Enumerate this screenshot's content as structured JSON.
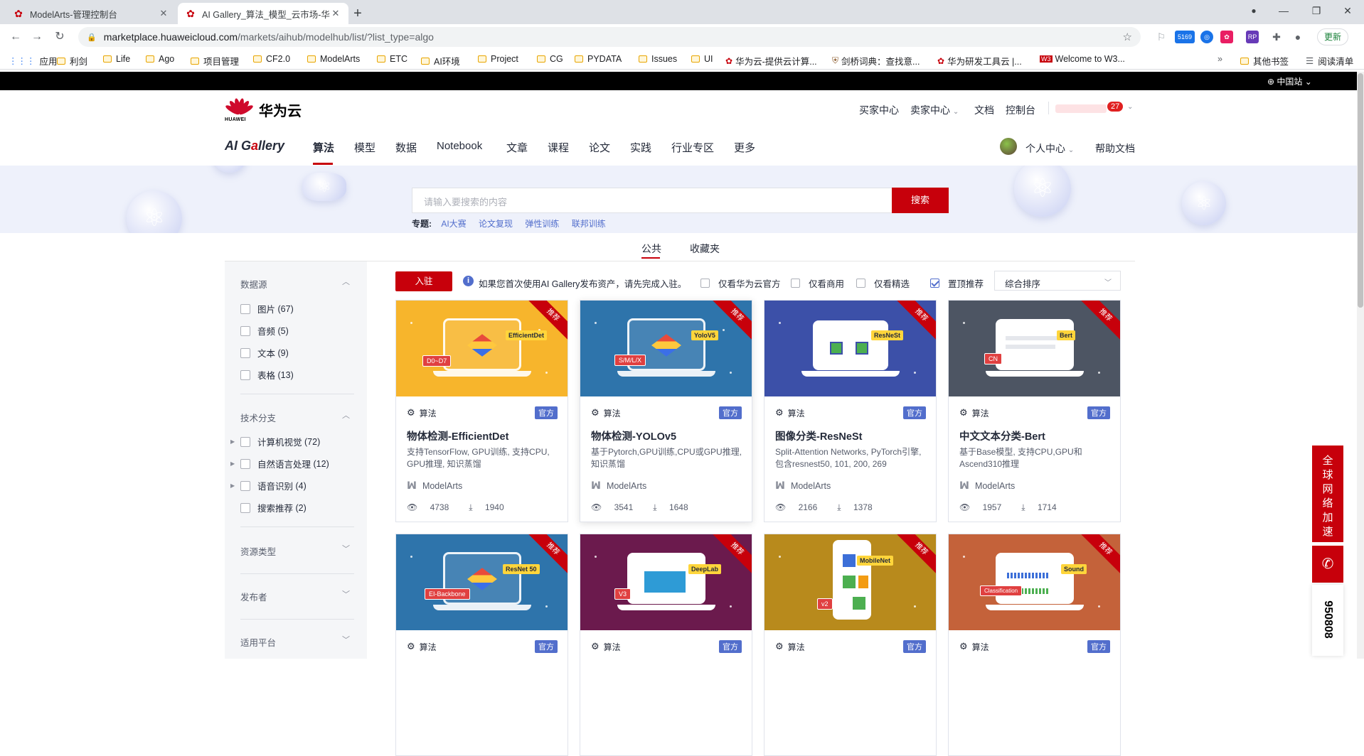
{
  "browser": {
    "tabs": [
      {
        "title": "ModelArts-管理控制台",
        "active": false
      },
      {
        "title": "AI Gallery_算法_模型_云市场-华",
        "active": true
      }
    ],
    "url_host": "marketplace.huaweicloud.com",
    "url_path": "/markets/aihub/modelhub/list/?list_type=algo",
    "ext_badge": "5169",
    "update_label": "更新",
    "bookmarks": [
      "应用",
      "利剑",
      "Life",
      "Ago",
      "项目管理",
      "CF2.0",
      "ModelArts",
      "ETC",
      "AI环境",
      "Project",
      "CG",
      "PYDATA",
      "Issues",
      "UI",
      "华为云-提供云计算...",
      "剑桥词典：查找意...",
      "华为研发工具云 |...",
      "Welcome to W3...",
      "»",
      "其他书签",
      "阅读清单"
    ]
  },
  "site": {
    "region": "中国站",
    "brand": "华为云",
    "logo_text": "HUAWEI",
    "top_links": [
      "买家中心",
      "卖家中心",
      "文档",
      "控制台"
    ],
    "msg_count": "27",
    "gallery_title_a": "AI G",
    "gallery_title_b": "a",
    "gallery_title_c": "llery",
    "nav": [
      "算法",
      "模型",
      "数据",
      "Notebook",
      "文章",
      "课程",
      "论文",
      "实践",
      "行业专区",
      "更多"
    ],
    "personal": "个人中心",
    "help": "帮助文档"
  },
  "search": {
    "placeholder": "请输入要搜索的内容",
    "button": "搜索",
    "topics_label": "专题:",
    "topics": [
      "AI大赛",
      "论文复现",
      "弹性训练",
      "联邦训练"
    ]
  },
  "tabs": [
    "公共",
    "收藏夹"
  ],
  "sidebar": {
    "groups": [
      {
        "title": "数据源",
        "items": [
          {
            "label": "图片",
            "count": "(67)"
          },
          {
            "label": "音频",
            "count": "(5)"
          },
          {
            "label": "文本",
            "count": "(9)"
          },
          {
            "label": "表格",
            "count": "(13)"
          }
        ]
      },
      {
        "title": "技术分支",
        "items": [
          {
            "label": "计算机视觉",
            "count": "(72)"
          },
          {
            "label": "自然语言处理",
            "count": "(12)"
          },
          {
            "label": "语音识别",
            "count": "(4)"
          },
          {
            "label": "搜索推荐",
            "count": "(2)"
          }
        ]
      },
      {
        "title": "资源类型",
        "items": []
      },
      {
        "title": "发布者",
        "items": []
      },
      {
        "title": "适用平台",
        "items": []
      }
    ]
  },
  "filters": {
    "join": "入驻",
    "info": "如果您首次使用AI Gallery发布资产，请先完成入驻。",
    "checks": [
      {
        "label": "仅看华为云官方",
        "checked": false
      },
      {
        "label": "仅看商用",
        "checked": false
      },
      {
        "label": "仅看精选",
        "checked": false
      },
      {
        "label": "置顶推荐",
        "checked": true
      }
    ],
    "sort": "综合排序"
  },
  "card_common": {
    "ribbon": "推荐",
    "type": "算法",
    "official": "官方",
    "publisher": "ModelArts"
  },
  "cards": [
    {
      "title": "物体检测-EfficientDet",
      "desc": "支持TensorFlow, GPU训练, 支持CPU, GPU推理, 知识蒸馏",
      "views": "4738",
      "downloads": "1940",
      "bg": "#f7b52c",
      "tag": "EfficientDet",
      "tag2": "D0~D7"
    },
    {
      "title": "物体检测-YOLOv5",
      "desc": "基于Pytorch,GPU训练,CPU或GPU推理, 知识蒸馏",
      "views": "3541",
      "downloads": "1648",
      "bg": "#2e74ab",
      "tag": "YoloV5",
      "tag2": "S/M/L/X"
    },
    {
      "title": "图像分类-ResNeSt",
      "desc": "Split-Attention Networks, PyTorch引擎, 包含resnest50, 101, 200, 269",
      "views": "2166",
      "downloads": "1378",
      "bg": "#3c50a8",
      "tag": "ResNeSt",
      "tag2": ""
    },
    {
      "title": "中文文本分类-Bert",
      "desc": "基于Base模型, 支持CPU,GPU和Ascend310推理",
      "views": "1957",
      "downloads": "1714",
      "bg": "#4d5563",
      "tag": "Bert",
      "tag2": "CN"
    },
    {
      "title": "",
      "desc": "",
      "views": "",
      "downloads": "",
      "bg": "#2e74ab",
      "tag": "ResNet 50",
      "tag2": "EI-Backbone"
    },
    {
      "title": "",
      "desc": "",
      "views": "",
      "downloads": "",
      "bg": "#6b1a4d",
      "tag": "DeepLab",
      "tag2": "V3"
    },
    {
      "title": "",
      "desc": "",
      "views": "",
      "downloads": "",
      "bg": "#b88a1c",
      "tag": "MobileNet",
      "tag2": "v2"
    },
    {
      "title": "",
      "desc": "",
      "views": "",
      "downloads": "",
      "bg": "#c4623a",
      "tag": "Sound",
      "tag2": "Classification"
    }
  ],
  "float": {
    "accel": "全球网络加速",
    "phone": "950808"
  }
}
